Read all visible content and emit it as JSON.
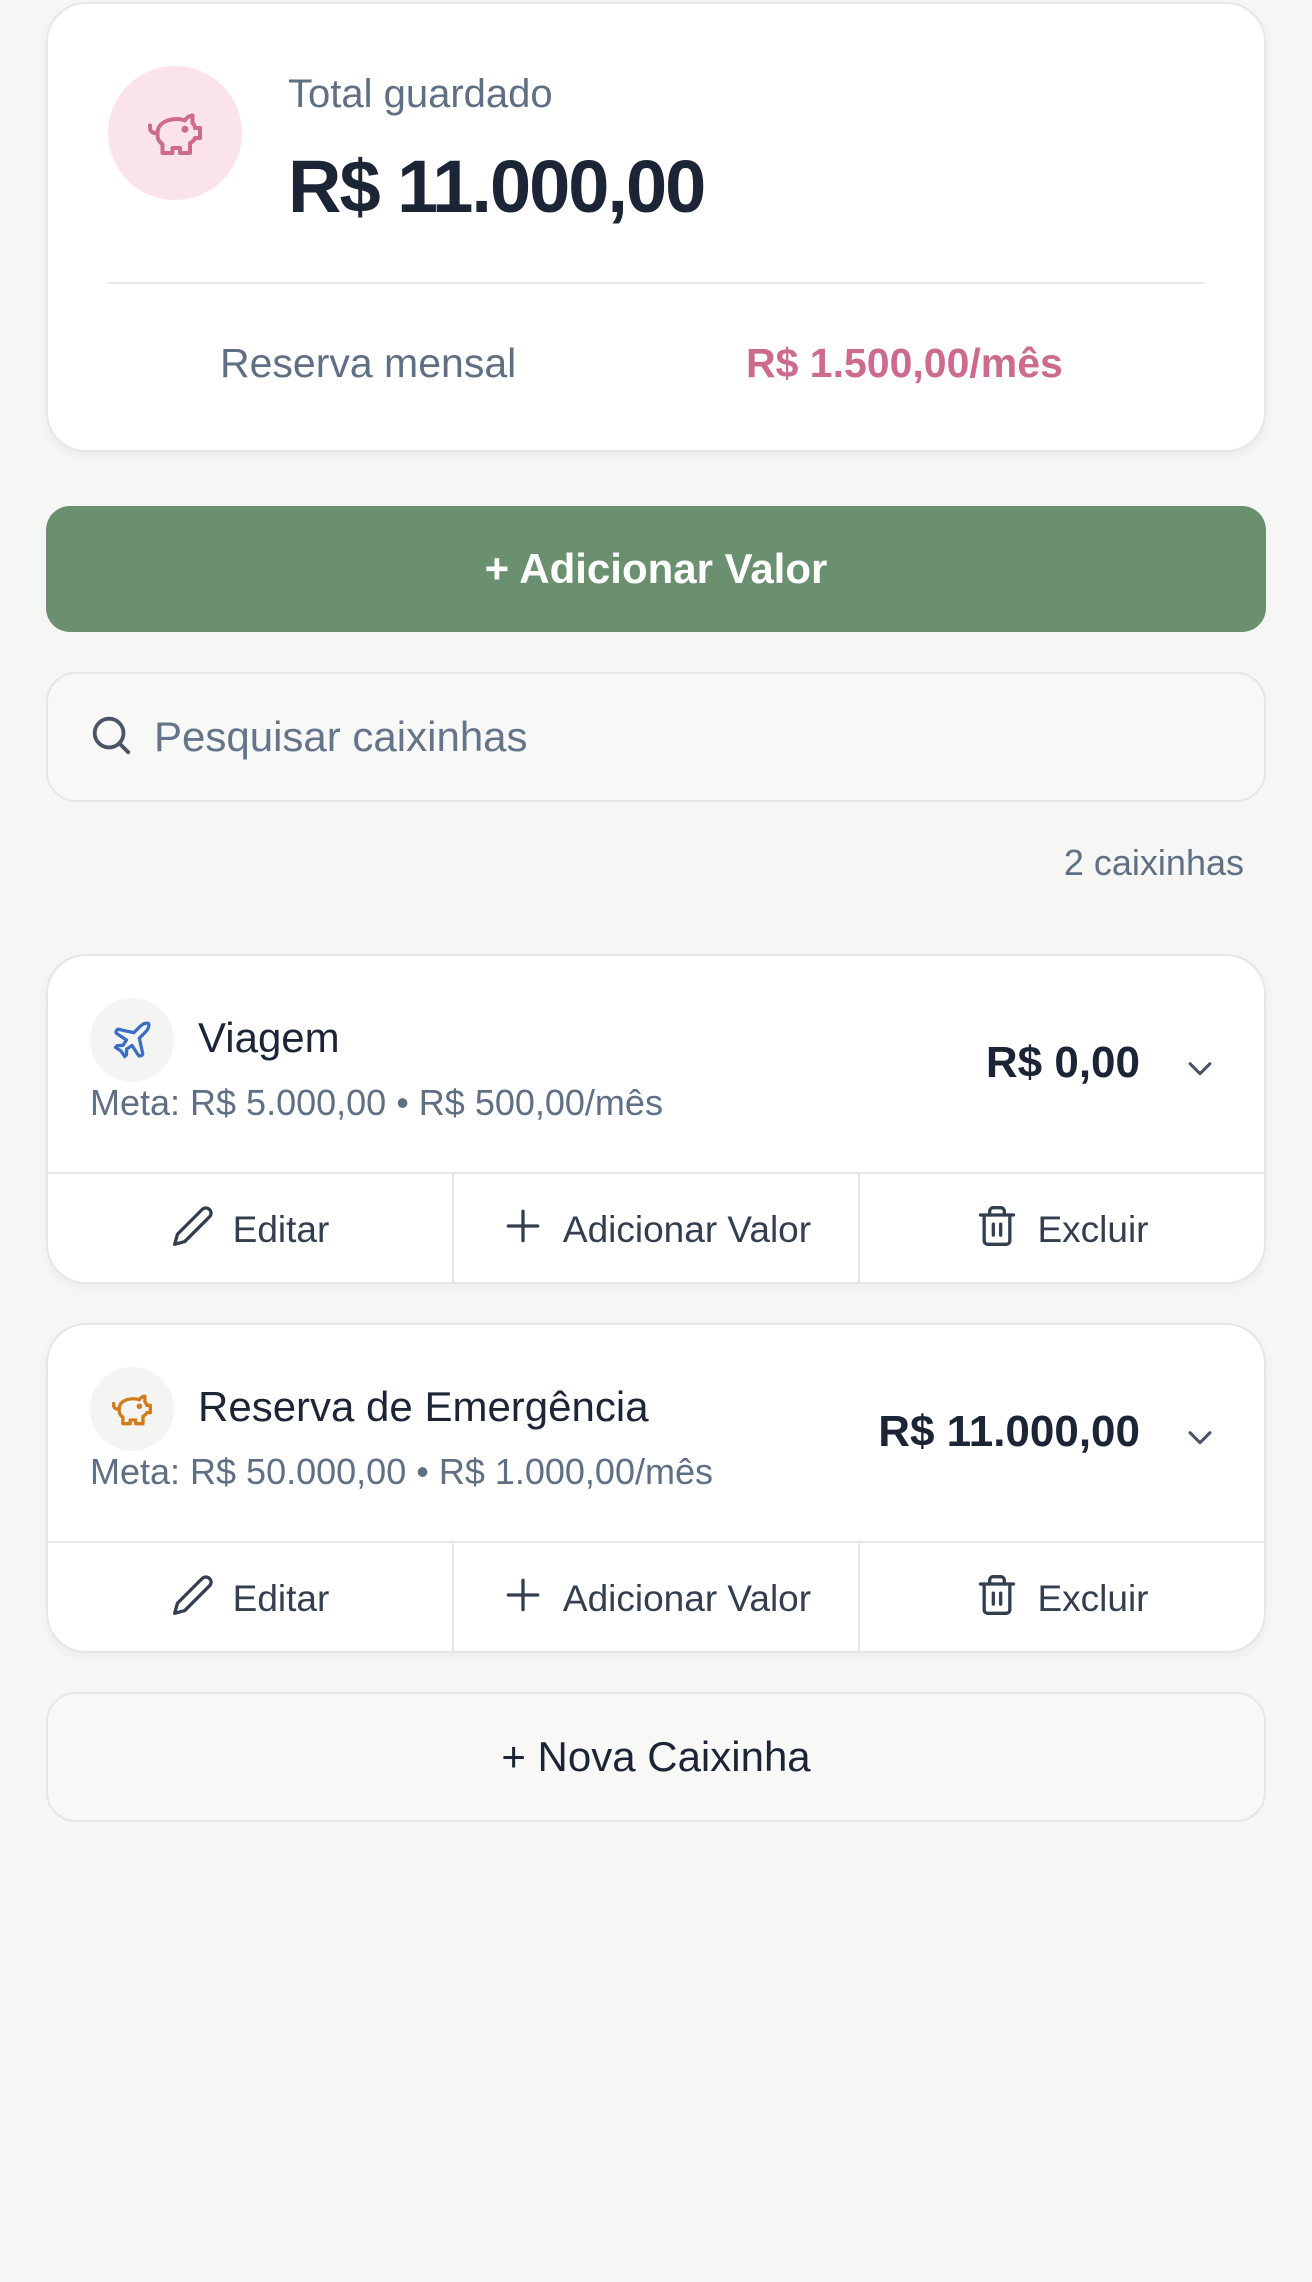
{
  "summary": {
    "total_label": "Total guardado",
    "total_value": "R$ 11.000,00",
    "reserve_label": "Reserva mensal",
    "reserve_value": "R$ 1.500,00/mês",
    "icon": "piggy-bank-icon"
  },
  "actions": {
    "add_value_label": "+ Adicionar Valor"
  },
  "search": {
    "placeholder": "Pesquisar caixinhas",
    "value": ""
  },
  "list": {
    "count_label": "2 caixinhas"
  },
  "boxes": [
    {
      "name": "Viagem",
      "meta": "Meta: R$ 5.000,00 • R$ 500,00/mês",
      "amount": "R$ 0,00",
      "icon": "plane-icon",
      "icon_color": "#3b6fc4",
      "edit_label": "Editar",
      "add_label": "Adicionar Valor",
      "delete_label": "Excluir"
    },
    {
      "name": "Reserva de Emergência",
      "meta": "Meta: R$ 50.000,00 • R$ 1.000,00/mês",
      "amount": "R$ 11.000,00",
      "icon": "piggy-bank-icon",
      "icon_color": "#d37a1c",
      "edit_label": "Editar",
      "add_label": "Adicionar Valor",
      "delete_label": "Excluir"
    }
  ],
  "footer": {
    "new_box_label": "+ Nova Caixinha"
  },
  "colors": {
    "accent_green": "#6b9070",
    "accent_pink": "#cc6b8d",
    "text_dark": "#1c2536",
    "text_muted": "#5f6f84"
  }
}
